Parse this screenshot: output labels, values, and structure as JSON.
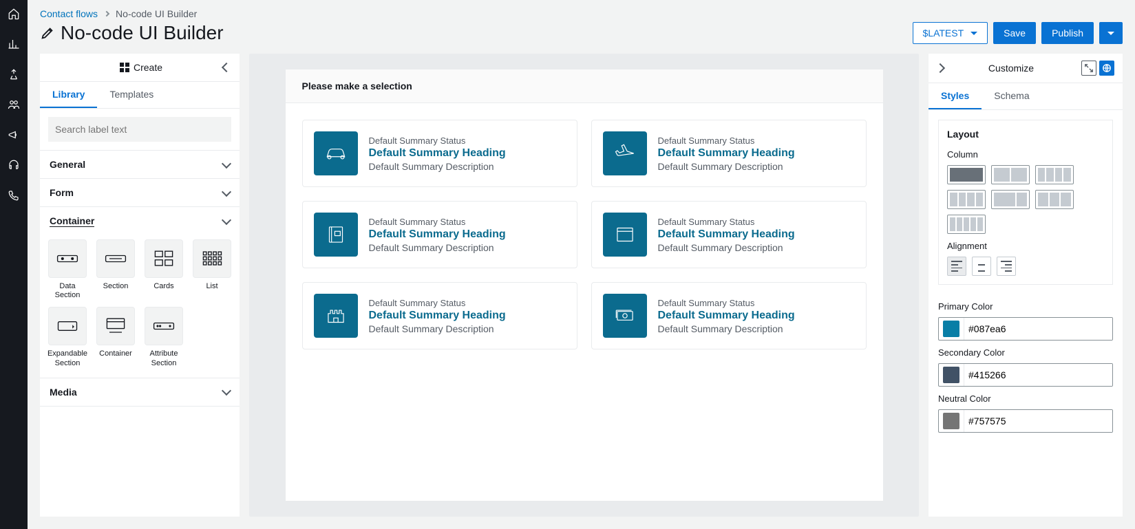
{
  "breadcrumb": {
    "parent": "Contact flows",
    "current": "No-code UI Builder"
  },
  "page_title": "No-code UI Builder",
  "actions": {
    "latest": "$LATEST",
    "save": "Save",
    "publish": "Publish"
  },
  "left_panel": {
    "header": "Create",
    "tabs": {
      "library": "Library",
      "templates": "Templates"
    },
    "search_placeholder": "Search label text",
    "accordions": {
      "general": "General",
      "form": "Form",
      "container": "Container",
      "media": "Media"
    },
    "components": {
      "data_section": "Data Section",
      "section": "Section",
      "cards": "Cards",
      "list": "List",
      "expandable_section": "Expandable Section",
      "container": "Container",
      "attribute_section": "Attribute Section"
    }
  },
  "canvas": {
    "title": "Please make a selection",
    "card_defaults": {
      "status": "Default Summary Status",
      "heading": "Default Summary Heading",
      "desc": "Default Summary Description"
    }
  },
  "right_panel": {
    "header": "Customize",
    "tabs": {
      "styles": "Styles",
      "schema": "Schema"
    },
    "layout_title": "Layout",
    "column_label": "Column",
    "alignment_label": "Alignment",
    "primary_label": "Primary Color",
    "primary_value": "#087ea6",
    "secondary_label": "Secondary Color",
    "secondary_value": "#415266",
    "neutral_label": "Neutral Color",
    "neutral_value": "#757575"
  }
}
